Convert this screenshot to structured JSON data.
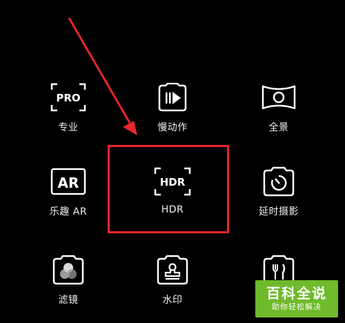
{
  "modes": {
    "pro": {
      "label": "专业",
      "icon": "pro-icon",
      "icon_text": "PRO"
    },
    "slow_motion": {
      "label": "慢动作",
      "icon": "slow-motion-icon"
    },
    "panorama": {
      "label": "全景",
      "icon": "panorama-icon"
    },
    "ar": {
      "label": "乐趣 AR",
      "icon": "ar-icon",
      "icon_text": "AR"
    },
    "hdr": {
      "label": "HDR",
      "icon": "hdr-icon",
      "icon_text": "HDR"
    },
    "time_lapse": {
      "label": "延时摄影",
      "icon": "time-lapse-icon"
    },
    "filter": {
      "label": "滤镜",
      "icon": "filter-icon"
    },
    "watermark": {
      "label": "水印",
      "icon": "stamp-icon"
    },
    "food": {
      "label": "",
      "icon": "food-icon"
    }
  },
  "annotation": {
    "highlight_color": "#e8262b",
    "highlighted_mode": "hdr"
  },
  "site_watermark": {
    "title": "百科全说",
    "subtitle": "助你轻松解决",
    "color": "#6fba2c"
  }
}
